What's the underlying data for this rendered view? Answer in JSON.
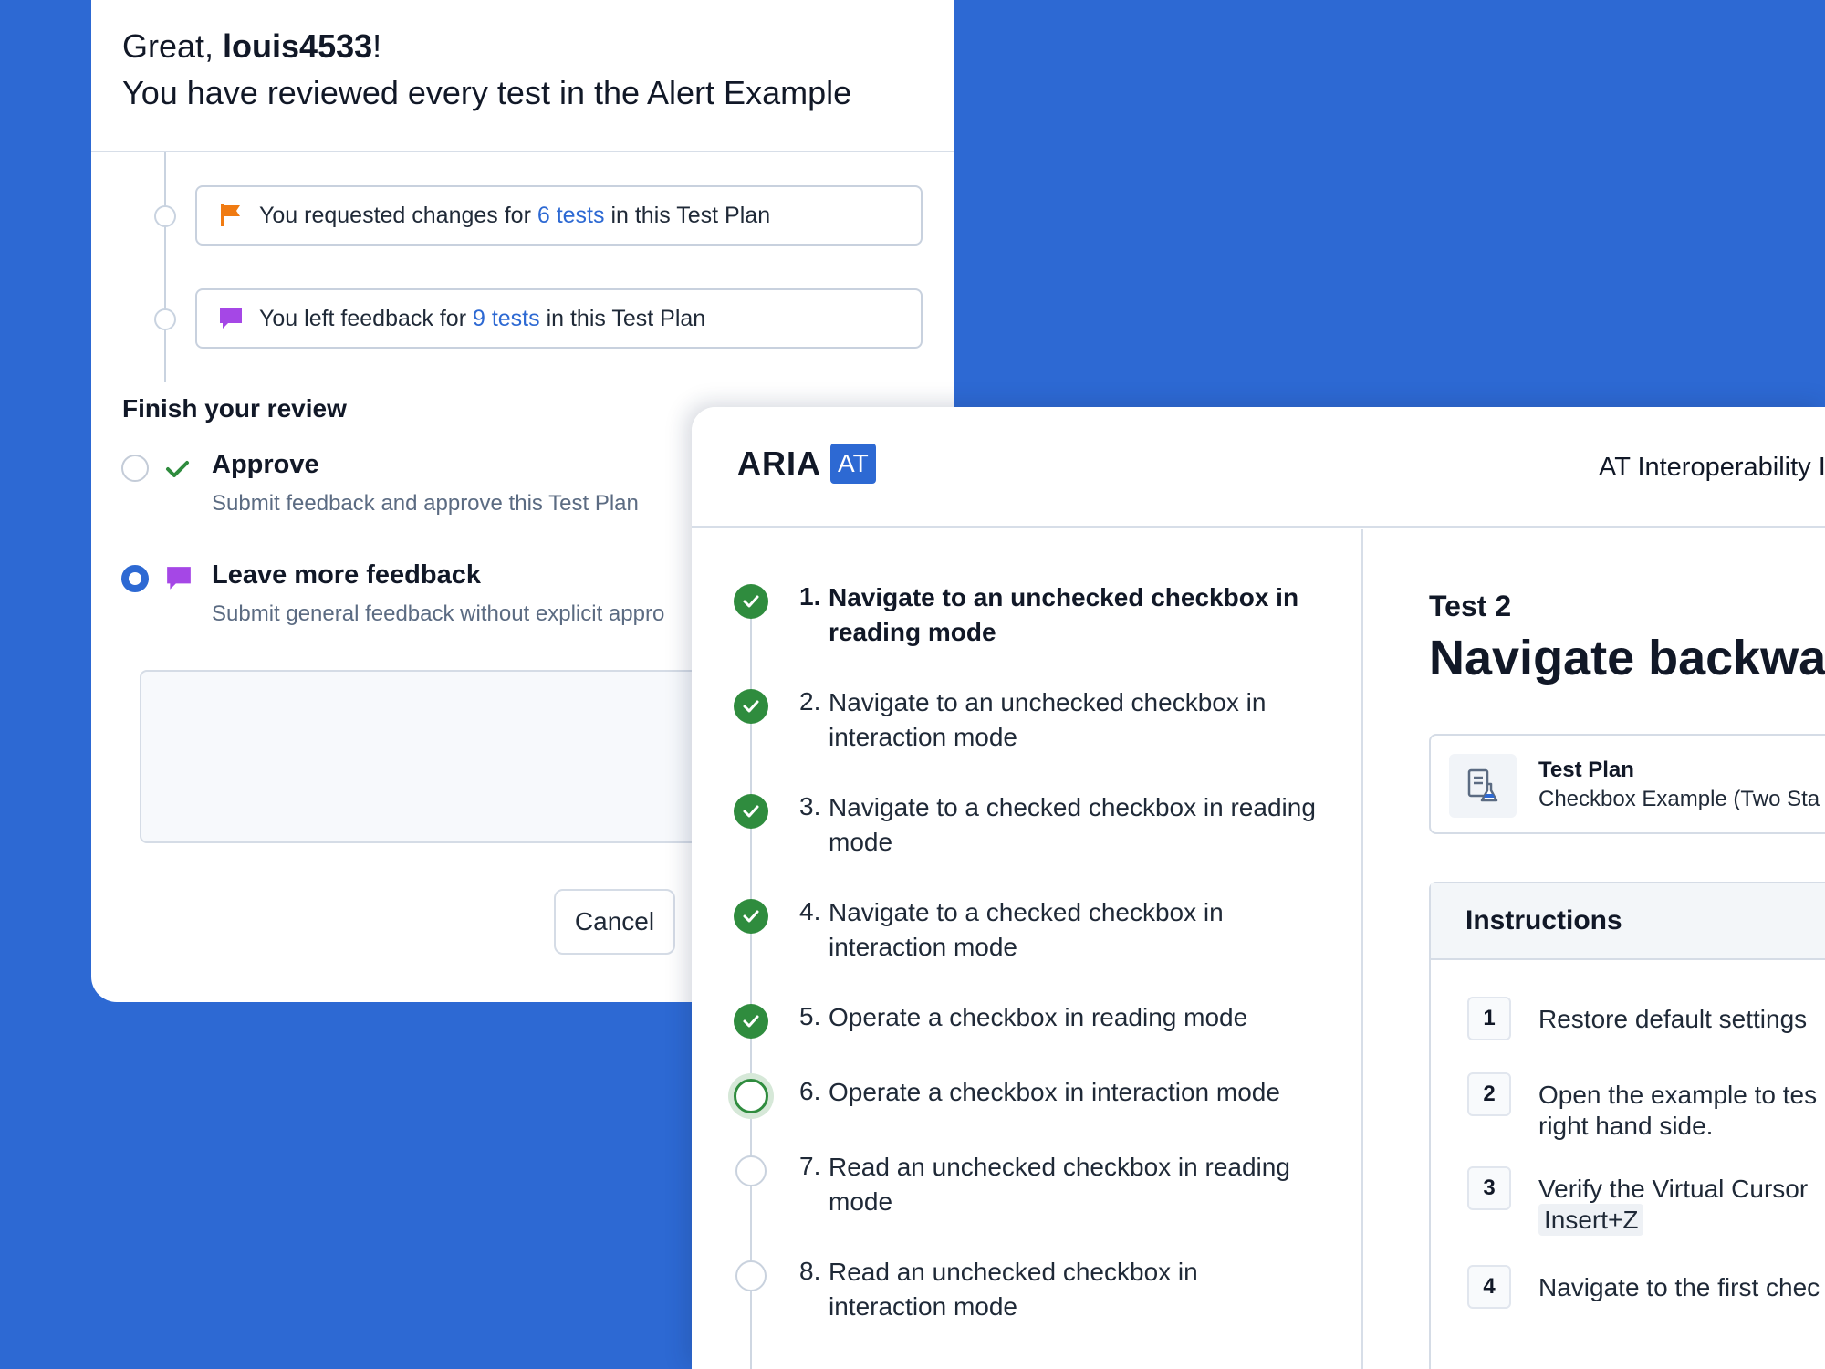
{
  "review_modal": {
    "greeting_prefix": "Great, ",
    "username": "louis4533",
    "greeting_suffix": "!",
    "subline": "You have reviewed every test in the Alert Example",
    "summaries": [
      {
        "icon": "flag-icon",
        "color": "#f07b12",
        "prefix": "You requested changes for ",
        "link": "6 tests",
        "suffix": " in this Test Plan"
      },
      {
        "icon": "speech-bubble-icon",
        "color": "#a547e6",
        "prefix": "You left feedback for ",
        "link": "9 tests",
        "suffix": " in this Test Plan"
      }
    ],
    "finish_title": "Finish your review",
    "options": [
      {
        "title": "Approve",
        "description": "Submit feedback and approve this Test Plan",
        "selected": false
      },
      {
        "title": "Leave more feedback",
        "description": "Submit general feedback without explicit appro",
        "selected": true
      }
    ],
    "cancel_label": "Cancel"
  },
  "app": {
    "logo_text": "ARIA",
    "logo_badge": "AT",
    "header_title": "AT Interoperability I",
    "brand_color": "#2d69d3",
    "steps": [
      {
        "num": "1.",
        "text": "Navigate to an unchecked checkbox in reading mode",
        "status": "done",
        "active": true
      },
      {
        "num": "2.",
        "text": "Navigate to an unchecked checkbox  in interaction mode",
        "status": "done",
        "active": false
      },
      {
        "num": "3.",
        "text": "Navigate to a checked checkbox in reading mode",
        "status": "done",
        "active": false
      },
      {
        "num": "4.",
        "text": "Navigate to a checked checkbox in interaction mode",
        "status": "done",
        "active": false
      },
      {
        "num": "5.",
        "text": "Operate a checkbox in reading mode",
        "status": "done",
        "active": false
      },
      {
        "num": "6.",
        "text": "Operate a checkbox in interaction mode",
        "status": "current",
        "active": false
      },
      {
        "num": "7.",
        "text": "Read an unchecked checkbox in reading mode",
        "status": "todo",
        "active": false
      },
      {
        "num": "8.",
        "text": "Read an unchecked checkbox in interaction mode",
        "status": "todo",
        "active": false
      }
    ],
    "test_label": "Test 2",
    "test_title": "Navigate backwar",
    "test_plan_label": "Test Plan",
    "test_plan_value": "Checkbox Example (Two Sta",
    "instructions_title": "Instructions",
    "instructions": [
      {
        "num": "1",
        "line1": "Restore default settings",
        "line2": ""
      },
      {
        "num": "2",
        "line1": "Open the example to tes",
        "line2": "right hand side."
      },
      {
        "num": "3",
        "line1": "Verify the Virtual Cursor",
        "line2": "Insert+Z"
      },
      {
        "num": "4",
        "line1": "Navigate to the first chec",
        "line2": ""
      }
    ]
  }
}
